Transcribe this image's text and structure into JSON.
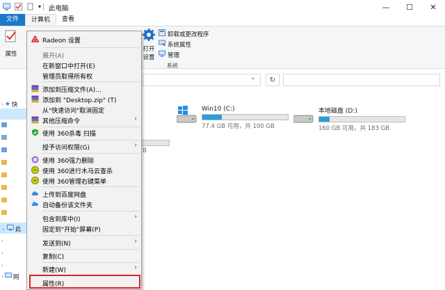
{
  "window": {
    "title": "此电脑",
    "minimize": "—",
    "maximize": "☐",
    "close": "✕"
  },
  "tabs": [
    "文件",
    "计算机",
    "查看"
  ],
  "ribbon": {
    "properties_label": "属性",
    "open_settings_line1": "打开",
    "open_settings_line2": "设置",
    "uninstall_label": "卸载或更改程序",
    "system_props_label": "系统属性",
    "manage_label": "管理",
    "group_system": "系统"
  },
  "nav": {
    "quick": "快",
    "thispc": "此",
    "network": "网"
  },
  "drives": [
    {
      "name": "Win10 (C:)",
      "free": "77.4 GB 可用，共 100 GB",
      "used_fraction": 0.226
    },
    {
      "name": "本地磁盘 (D:)",
      "free": "160 GB 可用，共 183 GB",
      "used_fraction": 0.126
    }
  ],
  "partial_text": "B",
  "menu": {
    "radeon": "Radeon 设置",
    "expand": "展开(A)",
    "open_new_window": "在新窗口中打开(E)",
    "take_ownership": "管理员取得所有权",
    "add_to_archive": "添加到压缩文件(A)...",
    "add_to_zip": "添加到 \"Desktop.zip\" (T)",
    "unpin_quick": "从\"快速访问\"取消固定",
    "other_compress": "其他压缩命令",
    "scan_360": "使用 360杀毒 扫描",
    "grant_access": "授予访问权限(G)",
    "force_delete_360": "使用 360强力删除",
    "trojan_scan_360": "使用 360进行木马云查杀",
    "manage_menu_360": "使用 360管理右键菜单",
    "upload_baidu": "上传到百度网盘",
    "auto_backup": "自动备份该文件夹",
    "include_library": "包含到库中(I)",
    "pin_start": "固定到\"开始\"屏幕(P)",
    "send_to": "发送到(N)",
    "copy": "复制(C)",
    "new": "新建(W)",
    "properties": "属性(R)"
  },
  "colors": {
    "file_tab": "#1979ca",
    "drive_fill": "#26a0da",
    "highlight": "#e02020"
  }
}
